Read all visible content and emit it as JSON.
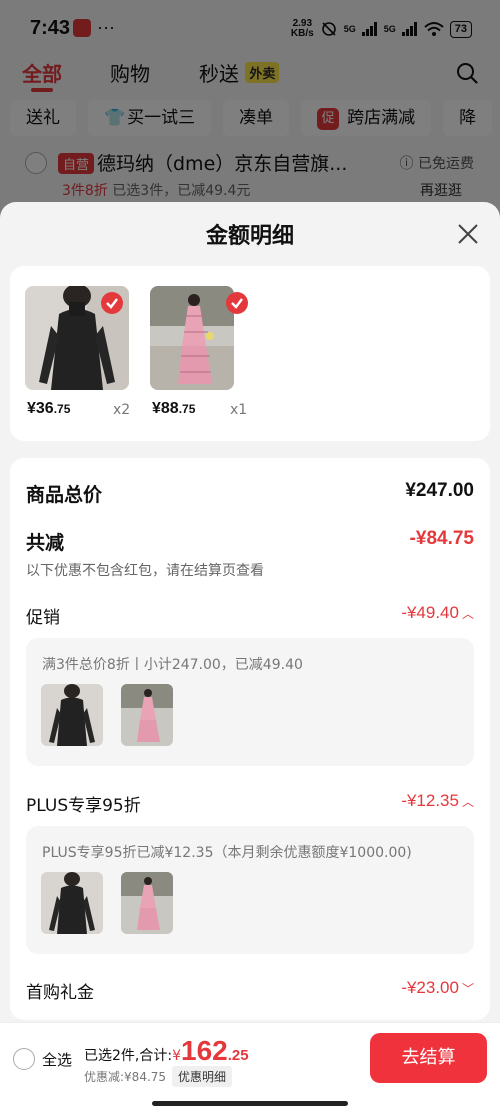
{
  "status_bar": {
    "time": "7:43",
    "dots": "···",
    "speed_value": "2.93",
    "speed_unit": "KB/s",
    "net1": "5G",
    "net2": "5G",
    "battery": "73"
  },
  "top_nav": {
    "tabs": [
      "全部",
      "购物",
      "秒送"
    ],
    "badge": "外卖",
    "active_index": 0
  },
  "chips": [
    "送礼",
    "买一试三",
    "凑单",
    "跨店满减",
    "降"
  ],
  "chip_promo_tag": "促",
  "store_row": {
    "self_tag": "自营",
    "name": "德玛纳（dme）京东自营旗...",
    "free_shipping": "ⓘ 已免运费",
    "sub_highlight": "3件8折",
    "sub_text": "已选3件，已减49.4元",
    "again": "再逛逛"
  },
  "sheet": {
    "title": "金额明细",
    "products": [
      {
        "price_int": "¥36",
        "price_dec": ".75",
        "qty": "x2",
        "image": "black-turtleneck-top"
      },
      {
        "price_int": "¥88",
        "price_dec": ".75",
        "qty": "x1",
        "image": "pink-plaid-dress"
      }
    ],
    "total_label": "商品总价",
    "total_value": "¥247.00",
    "reduce_label": "共减",
    "reduce_value": "-¥84.75",
    "reduce_hint": "以下优惠不包含红包，请在结算页查看",
    "promo": {
      "label": "促销",
      "value": "-¥49.40",
      "desc": "满3件总价8折丨小计247.00，已减49.40"
    },
    "plus": {
      "label": "PLUS专享95折",
      "value": "-¥12.35",
      "desc": "PLUS专享95折已减¥12.35（本月剩余优惠额度¥1000.00)"
    },
    "first": {
      "label": "首购礼金",
      "value": "-¥23.00"
    }
  },
  "bottom_bar": {
    "select_all": "全选",
    "selected_text": "已选2件,合计:",
    "currency": "¥",
    "amount_int": "162",
    "amount_dec": ".25",
    "discount_text": "优惠减:¥84.75",
    "detail_button": "优惠明细",
    "checkout": "去结算"
  },
  "colors": {
    "accent": "#e4393c",
    "checkout": "#f0323c",
    "badge": "#fce44b"
  }
}
